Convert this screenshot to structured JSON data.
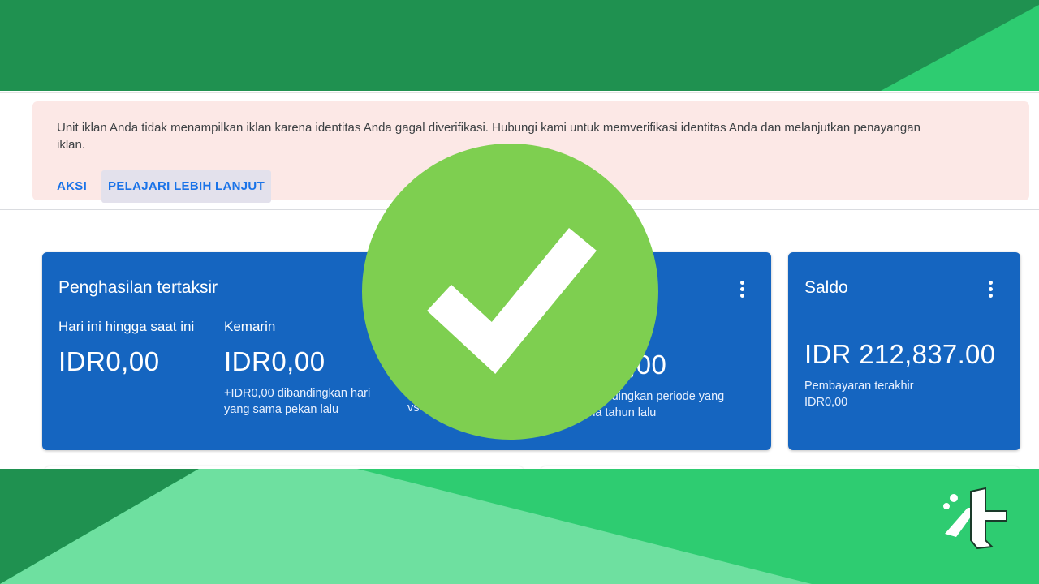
{
  "alert": {
    "message": "Unit iklan Anda tidak menampilkan iklan karena identitas Anda gagal diverifikasi. Hubungi kami untuk memverifikasi identitas Anda dan melanjutkan penayangan iklan.",
    "action_label": "AKSI",
    "learn_label": "PELAJARI LEBIH LANJUT"
  },
  "estimated": {
    "title": "Penghasilan tertaksir",
    "cols": [
      {
        "label": "Hari ini hingga saat ini",
        "value": "IDR0,00",
        "sub": ""
      },
      {
        "label": "Kemarin",
        "value": "IDR0,00",
        "sub": "+IDR0,00 dibandingkan hari yang sama pekan lalu"
      },
      {
        "label": "",
        "value": "",
        "sub": "vs"
      },
      {
        "label": "",
        "value": ",00",
        "sub": "0 dibandingkan periode yang sama tahun lalu"
      }
    ]
  },
  "balance": {
    "title": "Saldo",
    "value": "IDR 212,837.00",
    "last_payment_label": "Pembayaran terakhir",
    "last_payment_value": "IDR0,00"
  },
  "icons": {
    "check": "check-circle-icon",
    "more": "more-vert-icon",
    "logo": "brand-logo-icon"
  },
  "colors": {
    "green_dark": "#1e9150",
    "green_bright": "#2ecc71",
    "green_light": "#6ee0a0",
    "card_blue": "#1565c0",
    "check_green": "#7ecf50",
    "alert_bg": "#fce8e6",
    "link_blue": "#1a73e8"
  }
}
